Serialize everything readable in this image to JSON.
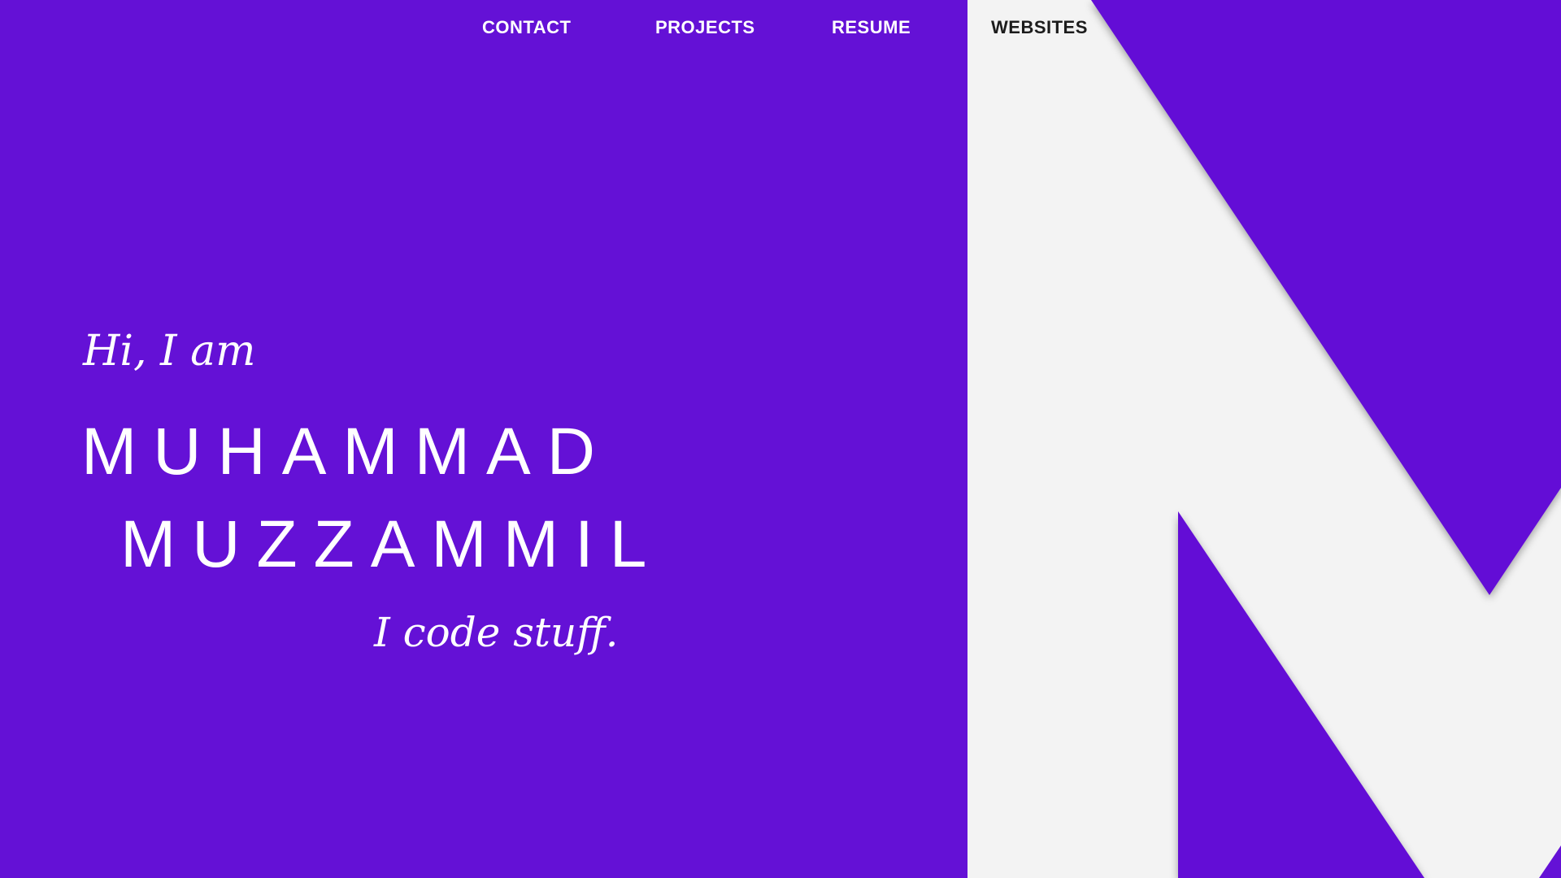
{
  "colors": {
    "background": "#6411d6",
    "logo_fill": "#f3f3f3",
    "text_light": "#ffffff",
    "text_dark": "#1c1c1c"
  },
  "nav": {
    "items": [
      {
        "label": "CONTACT"
      },
      {
        "label": "PROJECTS"
      },
      {
        "label": "RESUME"
      },
      {
        "label": "WEBSITES"
      }
    ]
  },
  "hero": {
    "greeting": "Hi, I am",
    "first_name": "MUHAMMAD",
    "last_name": "MUZZAMMIL",
    "tagline": "I code stuff."
  },
  "logo": {
    "icon": "m-logo-graphic"
  }
}
